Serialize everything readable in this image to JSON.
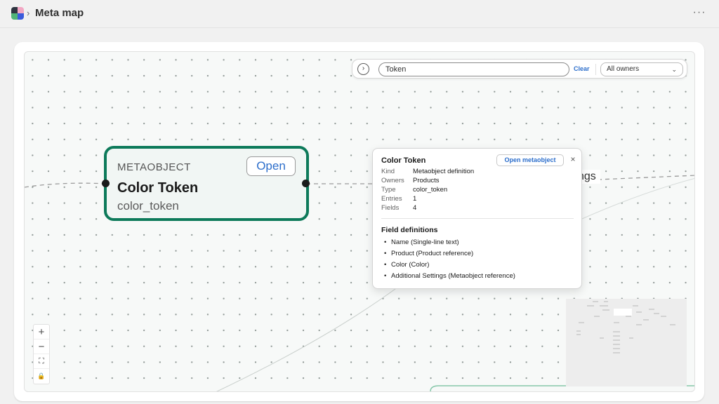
{
  "header": {
    "app_icon": "meta-map-app-icon",
    "separator": "›",
    "title": "Meta map",
    "more_label": "···"
  },
  "search": {
    "expand_icon": "chevron-right-icon",
    "expand_glyph": "›",
    "value": "Token",
    "clear_label": "Clear",
    "owner_filter": "All owners",
    "owner_chevron": "⌄"
  },
  "node": {
    "kind": "METAOBJECT",
    "open_label": "Open",
    "title": "Color Token",
    "handle": "color_token"
  },
  "edge_label_partial": "ngs",
  "popover": {
    "title": "Color Token",
    "open_label": "Open metaobject",
    "close_glyph": "×",
    "meta": [
      {
        "key": "Kind",
        "value": "Metaobject definition"
      },
      {
        "key": "Owners",
        "value": "Products"
      },
      {
        "key": "Type",
        "value": "color_token"
      },
      {
        "key": "Entries",
        "value": "1"
      },
      {
        "key": "Fields",
        "value": "4"
      }
    ],
    "fields_title": "Field definitions",
    "fields": [
      "Name (Single-line text)",
      "Product (Product reference)",
      "Color (Color)",
      "Additional Settings (Metaobject reference)"
    ]
  },
  "zoom": {
    "zoom_in": "+",
    "zoom_out": "−",
    "fit": "⛶",
    "lock": "🔒"
  },
  "colors": {
    "accent": "#0d7a5a",
    "link": "#2c6ecb",
    "node_bg": "#f1f6f4"
  }
}
